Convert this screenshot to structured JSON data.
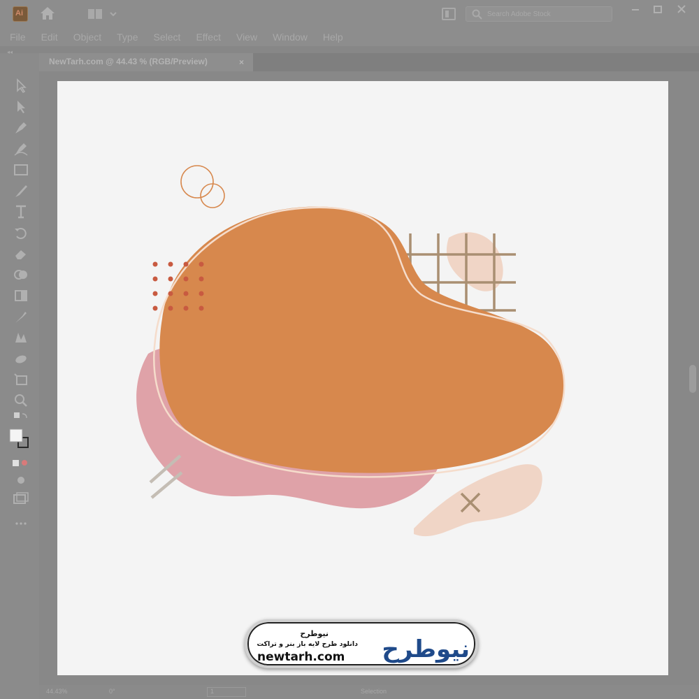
{
  "app": {
    "logo_text": "Ai",
    "search": {
      "placeholder": "Search Adobe Stock"
    }
  },
  "menu": [
    "File",
    "Edit",
    "Object",
    "Type",
    "Select",
    "Effect",
    "View",
    "Window",
    "Help"
  ],
  "document_tab": {
    "title": "NewTarh.com @ 44.43 % (RGB/Preview)",
    "close": "×"
  },
  "toolbar_tools": [
    "direct-selection-icon",
    "selection-icon",
    "pen-icon",
    "curvature-icon",
    "rectangle-icon",
    "paintbrush-icon",
    "type-icon",
    "rotate-icon",
    "eraser-icon",
    "shape-builder-icon",
    "gradient-icon",
    "eyedropper-icon",
    "blend-icon",
    "symbol-sprayer-icon",
    "artboard-icon",
    "zoom-icon",
    "swap-colors-icon",
    "fill-stroke-icon",
    "draw-mode-icon",
    "screen-mode-icon",
    "edit-toolbar-icon"
  ],
  "colors": {
    "orange_blob": "#d7884d",
    "pink_blob": "#dfa2a8",
    "peach_blob": "#f0d5c6",
    "grid_lines": "#a98f72",
    "dots": "#c85a40",
    "circles": "#d7884d",
    "outline": "#f5dccb"
  },
  "watermark": {
    "title": "نیوطرح",
    "subtitle": "دانلود طرح لایه باز بنر و تراکت",
    "url": "newtarh.com",
    "logo": "نیوطرح"
  },
  "status": {
    "zoom": "44.43%",
    "angle": "0°",
    "page": "1",
    "tool": "Selection"
  }
}
